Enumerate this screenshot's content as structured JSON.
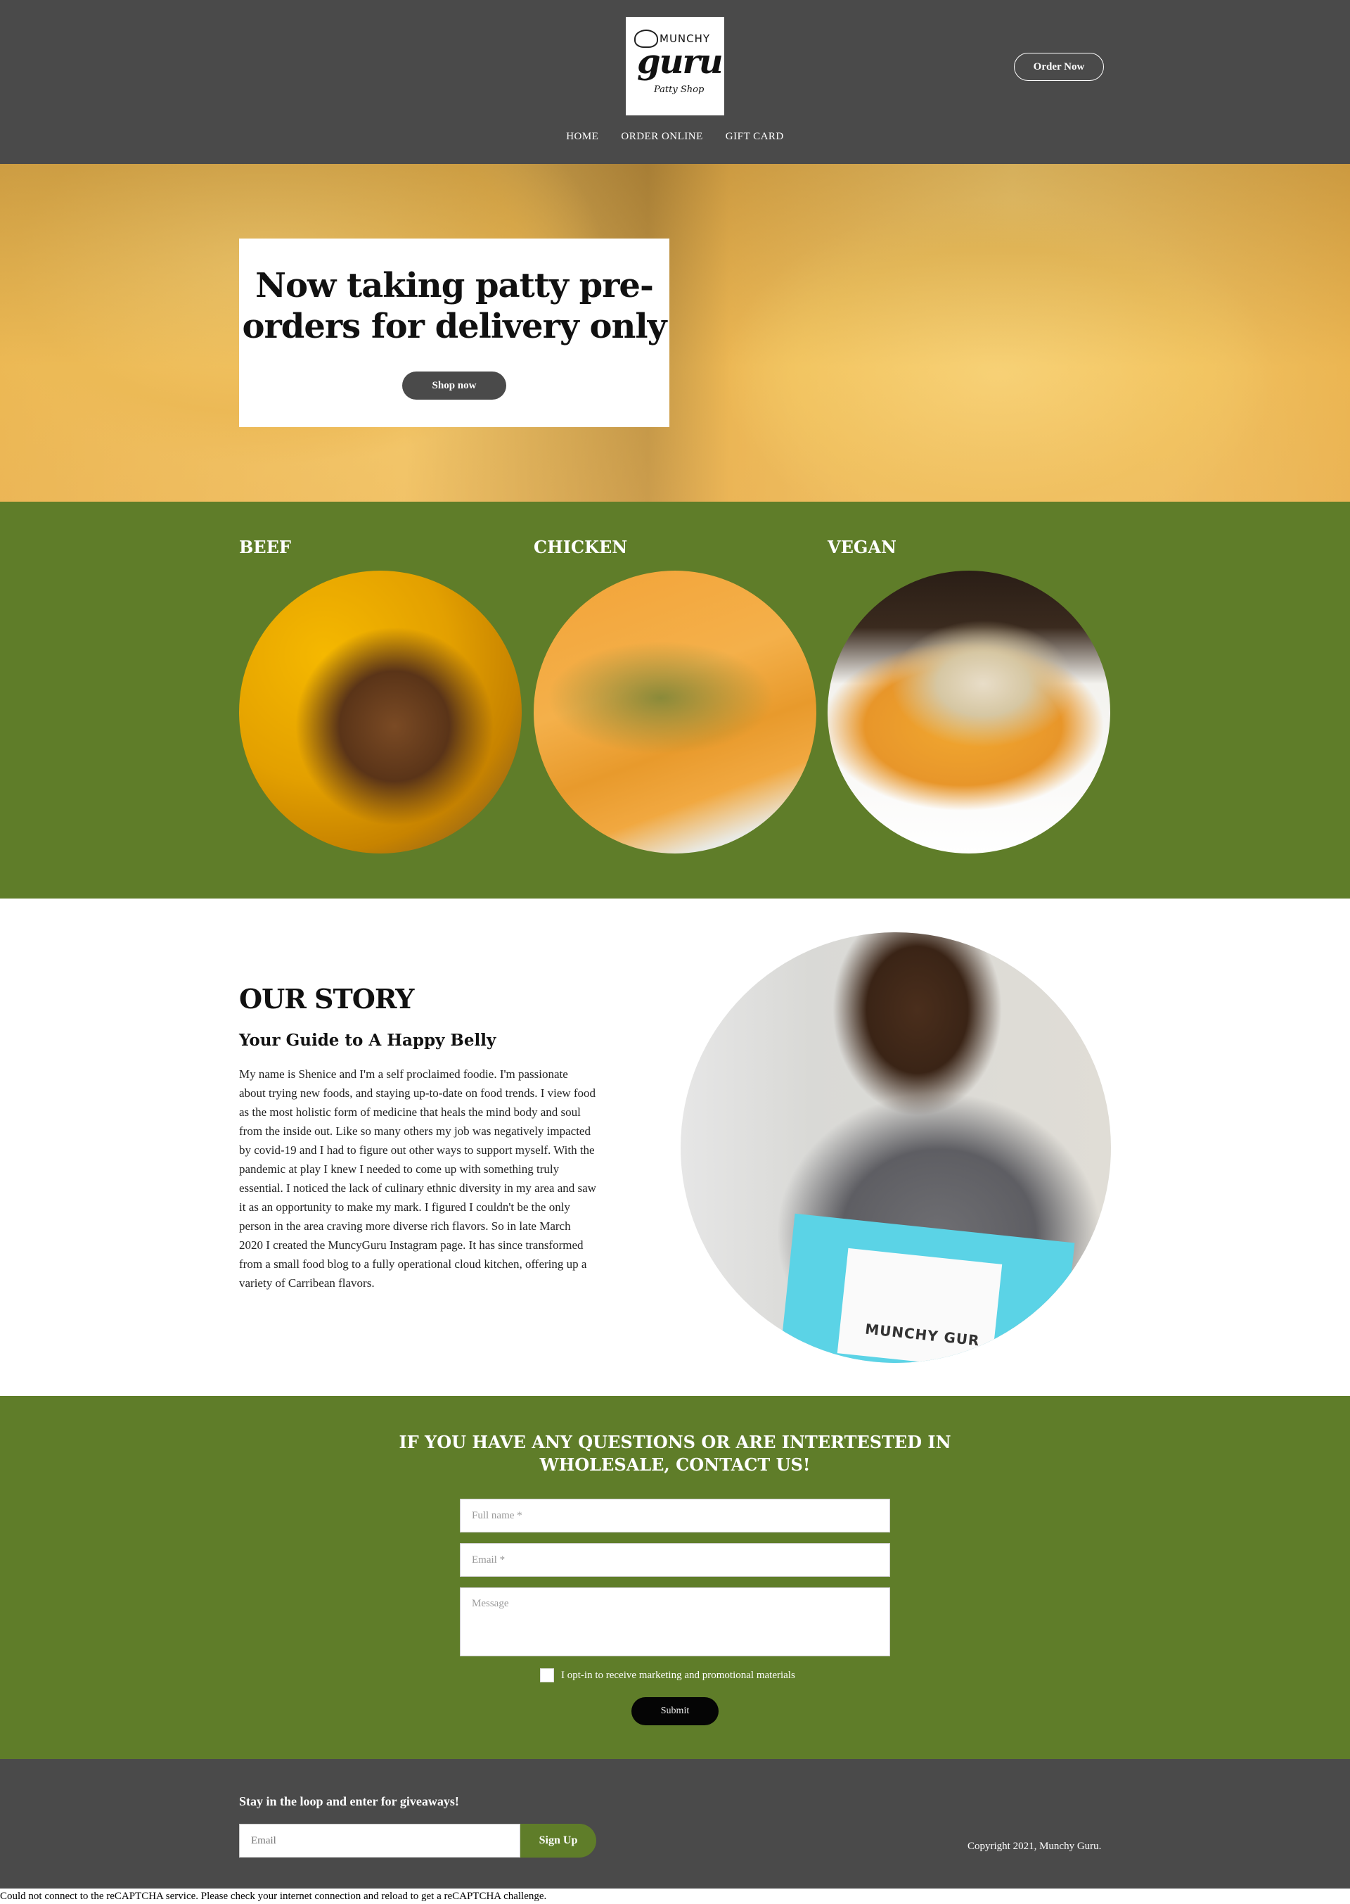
{
  "header": {
    "logo": {
      "brand_top": "MUNCHY",
      "brand_main": "guru",
      "brand_sub": "Patty Shop"
    },
    "order_now_label": "Order Now",
    "nav": [
      "HOME",
      "ORDER ONLINE",
      "GIFT CARD"
    ]
  },
  "hero": {
    "headline": "Now taking patty pre-orders for delivery only",
    "shop_now_label": "Shop now"
  },
  "patties": [
    {
      "name": "BEEF"
    },
    {
      "name": "CHICKEN"
    },
    {
      "name": "VEGAN"
    }
  ],
  "story": {
    "title": "OUR STORY",
    "subtitle": "Your Guide to A Happy Belly",
    "body": "My name is Shenice and I'm a self proclaimed foodie. I'm passionate about trying new foods, and staying up-to-date on food trends. I view food as the most holistic form of medicine that heals the mind body and soul from the inside out. Like so many others my job was negatively impacted by covid-19 and I had to figure out other ways to support myself. With the pandemic at play I knew I needed to come up with something truly essential. I noticed the lack of culinary ethnic diversity in my area and saw it as an opportunity to make my mark. I figured I couldn't be the only person in the area craving more diverse rich flavors. So in late March 2020 I created the MuncyGuru Instagram page. It has since transformed from a small food blog to a fully operational cloud kitchen, offering up a variety of Carribean flavors.",
    "photo_bag_text": "MUNCHY GUR"
  },
  "contact": {
    "heading": "IF YOU HAVE ANY QUESTIONS OR ARE INTERTESTED IN WHOLESALE, CONTACT US!",
    "fullname_placeholder": "Full name *",
    "email_placeholder": "Email *",
    "message_placeholder": "Message",
    "optin_label": "I opt-in to receive marketing and promotional materials",
    "submit_label": "Submit"
  },
  "footer": {
    "newsletter_heading": "Stay in the loop and enter for giveaways!",
    "email_placeholder": "Email",
    "signup_label": "Sign Up",
    "copyright": "Copyright 2021, Munchy Guru."
  },
  "recaptcha_notice": "Could not connect to the reCAPTCHA service. Please check your internet connection and reload to get a reCAPTCHA challenge.",
  "colors": {
    "header": "#4a4a4a",
    "green": "#5f7d29",
    "submit": "#050505"
  }
}
